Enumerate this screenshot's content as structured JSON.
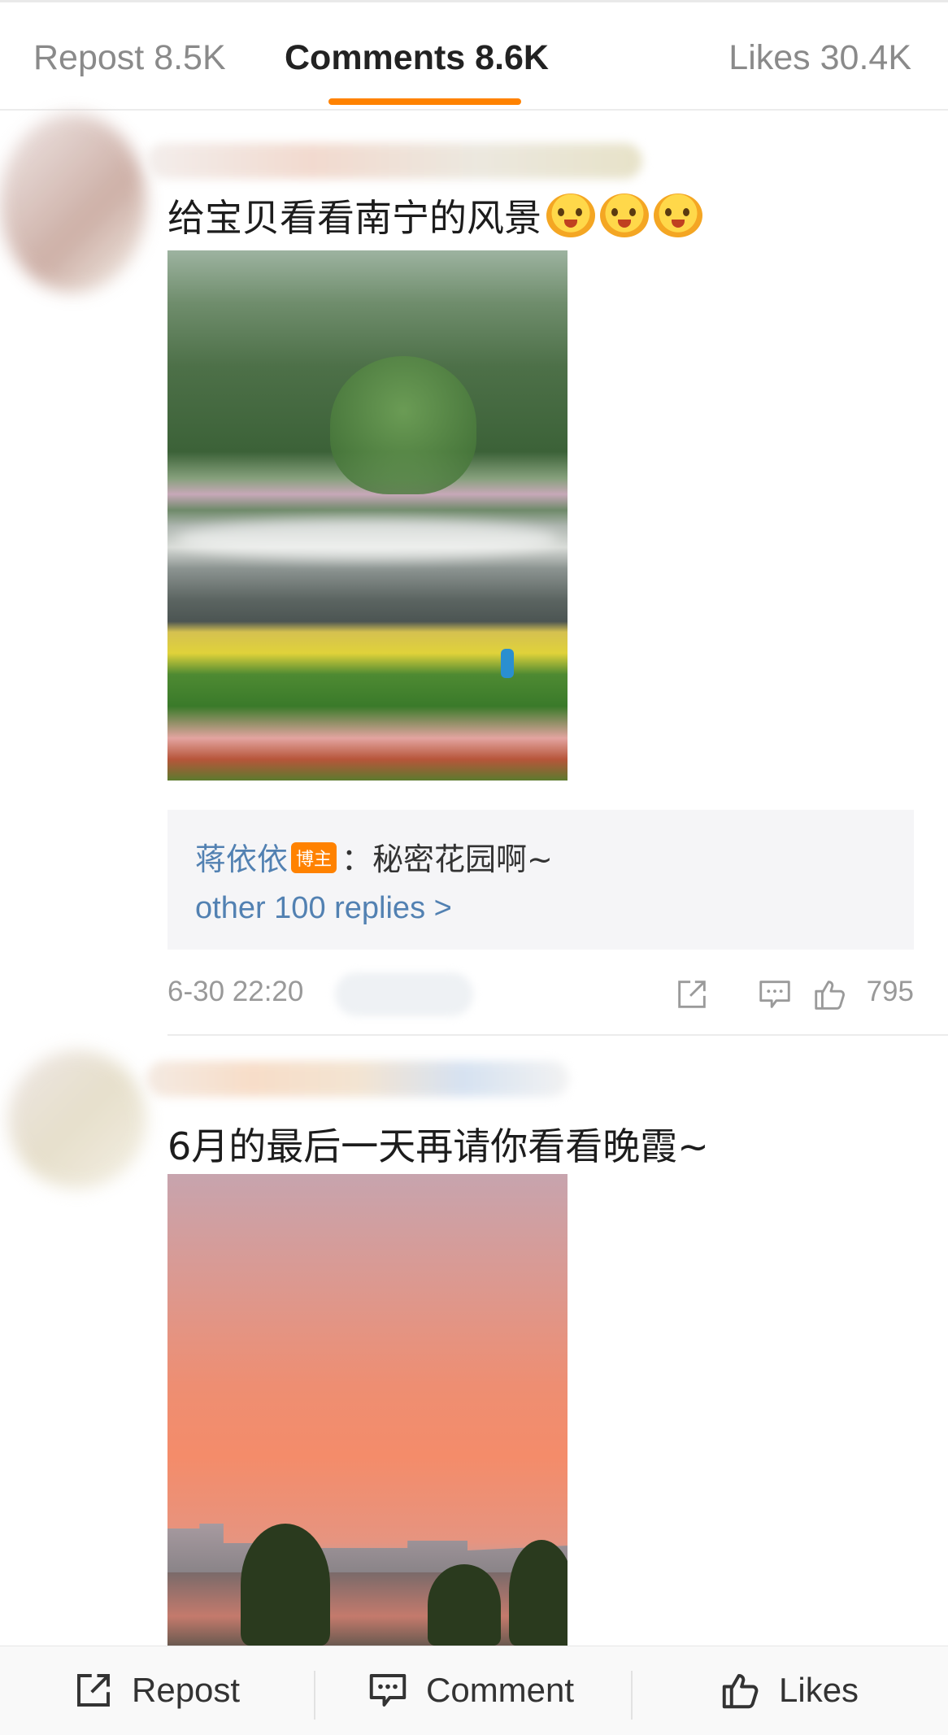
{
  "tabs": {
    "repost": "Repost 8.5K",
    "comments": "Comments 8.6K",
    "likes": "Likes 30.4K",
    "active_color": "#ff8200"
  },
  "comments": [
    {
      "text": "给宝贝看看南宁的风景",
      "emoji_count": 3,
      "photo": "lake-with-flowers-image",
      "reply": {
        "author": "蒋依依",
        "badge": "博主",
        "text": "：秘密花园啊~",
        "more": "other 100 replies >"
      },
      "timestamp": "6-30 22:20",
      "likes": "795",
      "icons": [
        "share-icon",
        "comment-icon",
        "like-icon"
      ]
    },
    {
      "text": "6月的最后一天再请你看看晚霞~",
      "photo": "sunset-image"
    }
  ],
  "bottom_bar": {
    "repost": "Repost",
    "comment": "Comment",
    "likes": "Likes"
  },
  "colors": {
    "link": "#5281b2",
    "accent": "#ff8200",
    "muted": "#999999"
  }
}
